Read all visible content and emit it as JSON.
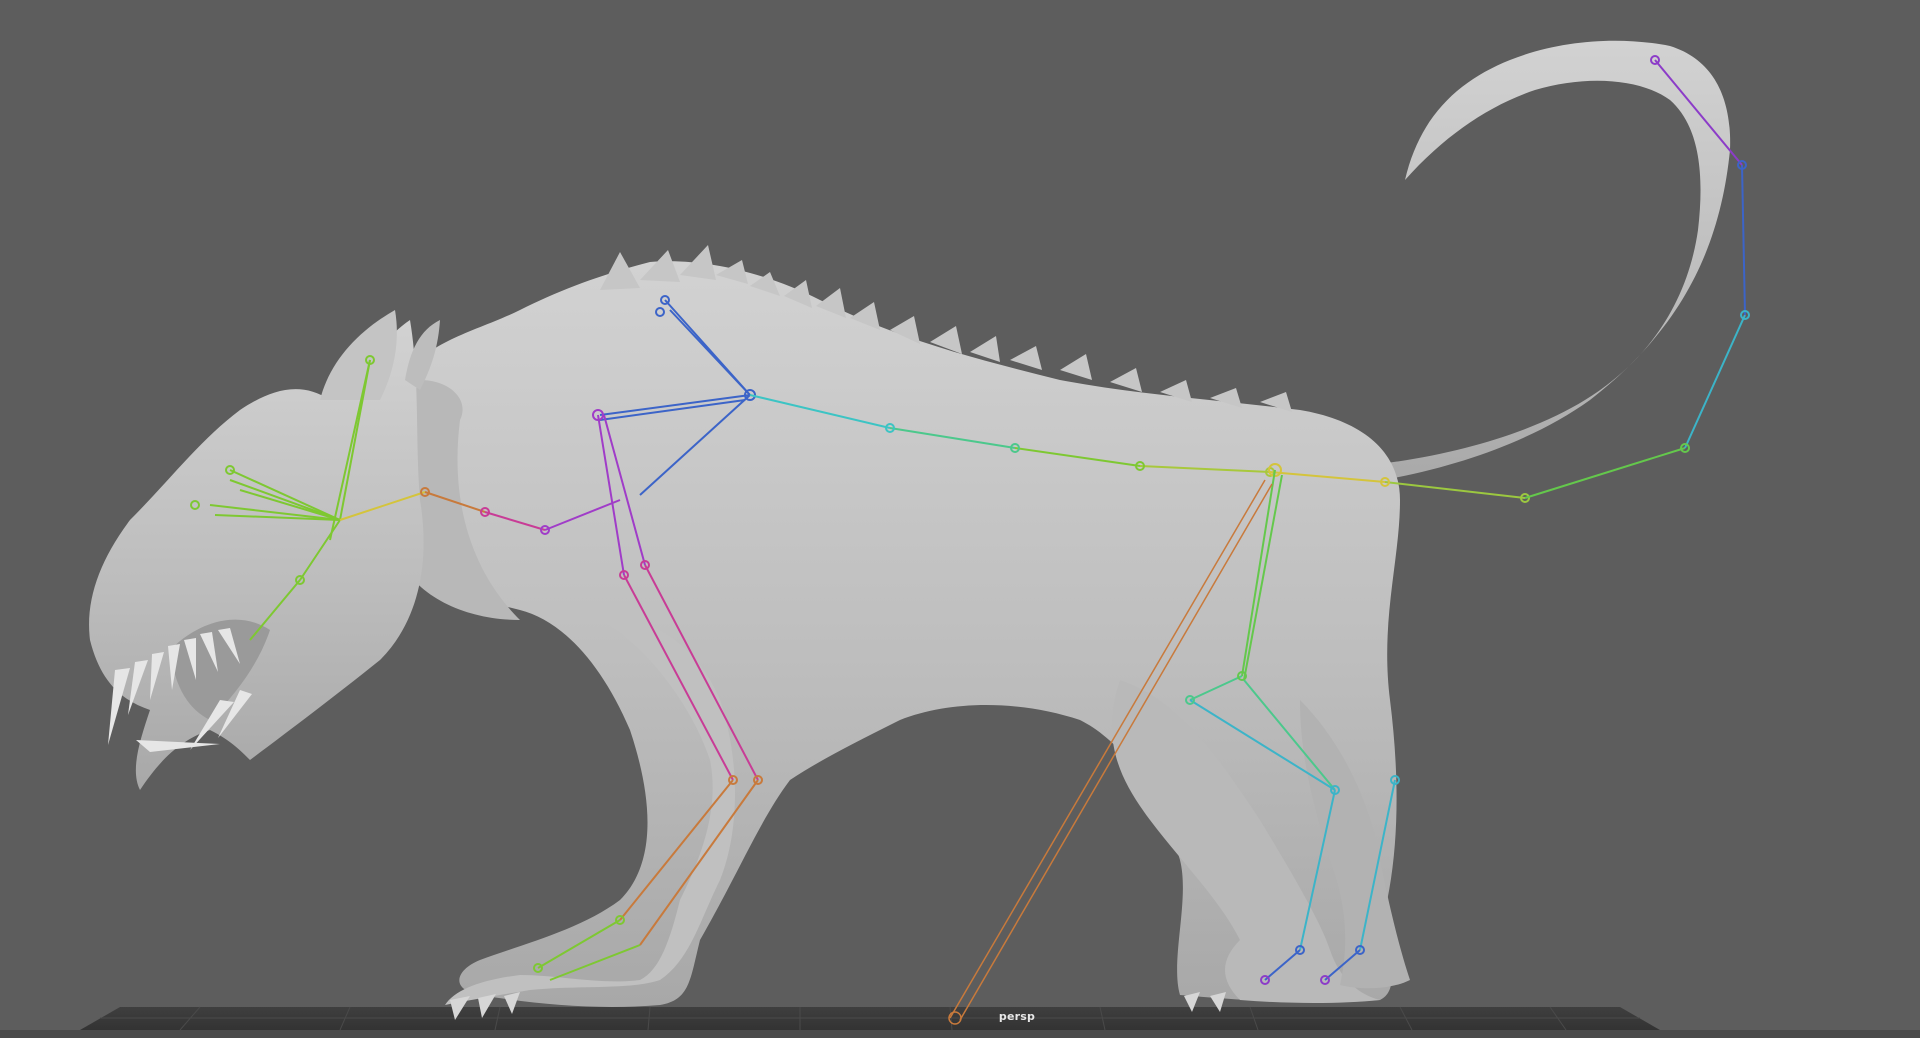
{
  "viewport": {
    "camera_label": "persp",
    "background_color": "#5d5d5d",
    "mesh_color": "#c4c4c4",
    "grid_color": "#3a3a3a"
  },
  "scene": {
    "model": "creature-sculpt",
    "joint_colors": {
      "head": "#7ec832",
      "neck": "#d4c43c",
      "spine": "#3cc4c4",
      "shoulder": "#3c64c8",
      "front-leg": "#a03cc8",
      "front-leg-lower": "#c83c96",
      "foot": "#c8823c",
      "hind-leg": "#64c84c",
      "hind-leg-lower": "#3cb4c8",
      "tail-tip": "#8c3cc8",
      "ik-handle": "#c87a3c"
    }
  }
}
